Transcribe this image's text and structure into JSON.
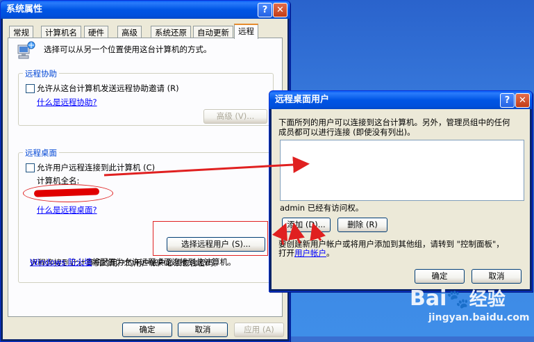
{
  "system_properties": {
    "title": "系统属性",
    "tabs": [
      "常规",
      "计算机名",
      "硬件",
      "高级",
      "系统还原",
      "自动更新",
      "远程"
    ],
    "intro_text": "选择可以从另一个位置使用这台计算机的方式。",
    "remote_assistance": {
      "group_title": "远程协助",
      "checkbox_label": "允许从这台计算机发送远程协助邀请 (R)",
      "help_link": "什么是远程协助?",
      "advanced_button": "高级 (V)..."
    },
    "remote_desktop": {
      "group_title": "远程桌面",
      "checkbox_label": "允许用户远程连接到此计算机 (C)",
      "computer_name_label": "计算机全名:",
      "help_link": "什么是远程桌面?",
      "select_users_button": "选择远程用户 (S)...",
      "password_note": "远程连接到此计算机的用户的用户帐户必须包含密码。",
      "firewall_link": "Windows 防火墙",
      "firewall_text": "将配置为允许远程桌面连接到此计算机。"
    },
    "buttons": {
      "ok": "确定",
      "cancel": "取消",
      "apply": "应用 (A)"
    }
  },
  "remote_desktop_users": {
    "title": "远程桌面用户",
    "description_line1": "下面所列的用户可以连接到这台计算机。另外，管理员组中的任何",
    "description_line2": "成员都可以进行连接 (即使没有列出)。",
    "access_note": "admin 已经有访问权。",
    "add_button": "添加 (D)...",
    "remove_button": "删除 (R)",
    "create_text_line1": "要创建新用户帐户或将用户添加到其他组，请转到 \"控制面板\"，",
    "create_prefix": "打开",
    "user_accounts_link": "用户帐户",
    "create_suffix": "。",
    "ok": "确定",
    "cancel": "取消"
  },
  "watermark": {
    "brand": "Bai",
    "brand_suffix": "经验",
    "url": "jingyan.baidu.com"
  },
  "colors": {
    "titlebar": "#0055e5",
    "dialog_face": "#ece9d8",
    "annotation_red": "#e02020",
    "link": "#0000ff"
  }
}
